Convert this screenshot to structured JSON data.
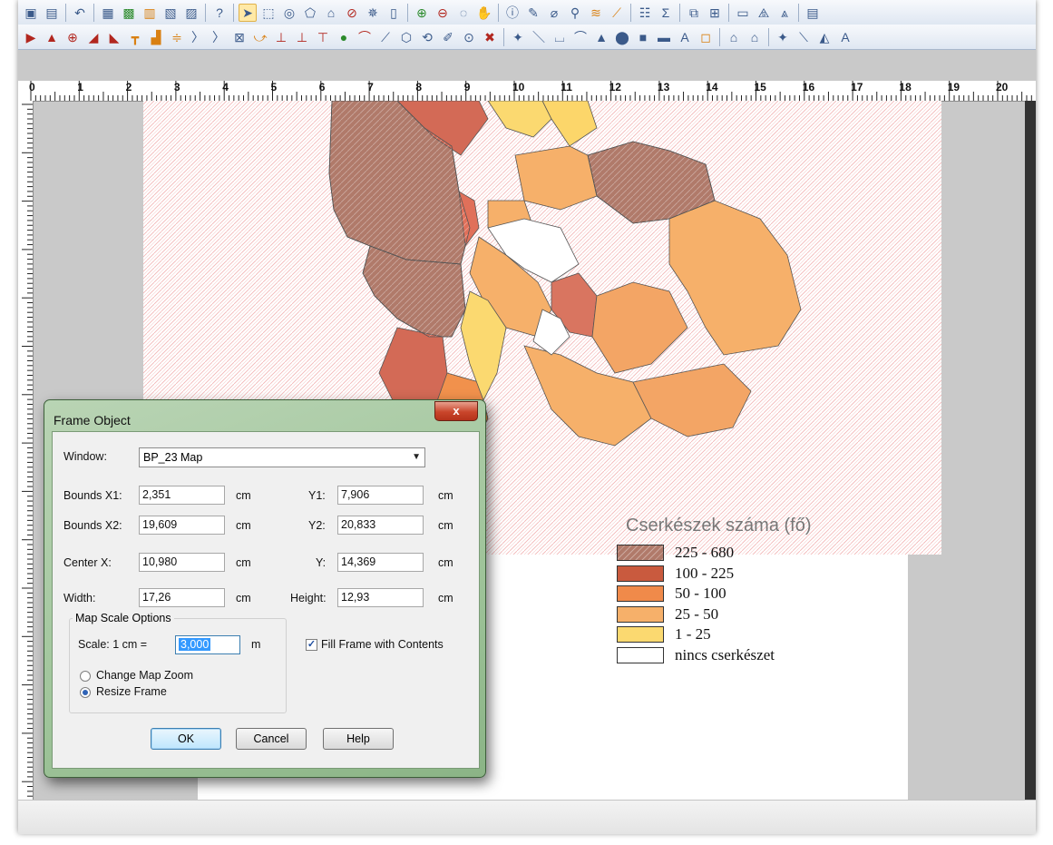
{
  "ruler": {
    "labels": [
      "0",
      "1",
      "2",
      "3",
      "4",
      "5",
      "6",
      "7",
      "8",
      "9",
      "10",
      "11",
      "12",
      "13",
      "14",
      "15",
      "16",
      "17",
      "18",
      "19",
      "20"
    ]
  },
  "legend": {
    "title": "Cserkészek száma (fő)",
    "items": [
      {
        "label": "225 - 680",
        "color": "#b07a6a"
      },
      {
        "label": "100 - 225",
        "color": "#c95a3e"
      },
      {
        "label": "50 - 100",
        "color": "#f08a4a"
      },
      {
        "label": "25 -  50",
        "color": "#f6b06a"
      },
      {
        "label": "1 -  25",
        "color": "#fbd970"
      },
      {
        "label": "nincs cserkészet",
        "color": "#ffffff"
      }
    ]
  },
  "dialog": {
    "title": "Frame Object",
    "close_label": "x",
    "window_label": "Window:",
    "window_value": "BP_23 Map",
    "bounds_x1_label": "Bounds X1:",
    "bounds_x1_value": "2,351",
    "bounds_x2_label": "Bounds X2:",
    "bounds_x2_value": "19,609",
    "center_x_label": "Center X:",
    "center_x_value": "10,980",
    "width_label": "Width:",
    "width_value": "17,26",
    "y1_label": "Y1:",
    "y1_value": "7,906",
    "y2_label": "Y2:",
    "y2_value": "20,833",
    "center_y_label": "Y:",
    "center_y_value": "14,369",
    "height_label": "Height:",
    "height_value": "12,93",
    "unit": "cm",
    "map_scale_label": "Map Scale Options",
    "scale_label": "Scale: 1 cm =",
    "scale_value": "3,000",
    "scale_unit": "m",
    "fill_frame_label": "Fill Frame with Contents",
    "change_zoom_label": "Change Map Zoom",
    "resize_frame_label": "Resize Frame",
    "ok_label": "OK",
    "cancel_label": "Cancel",
    "help_label": "Help"
  }
}
